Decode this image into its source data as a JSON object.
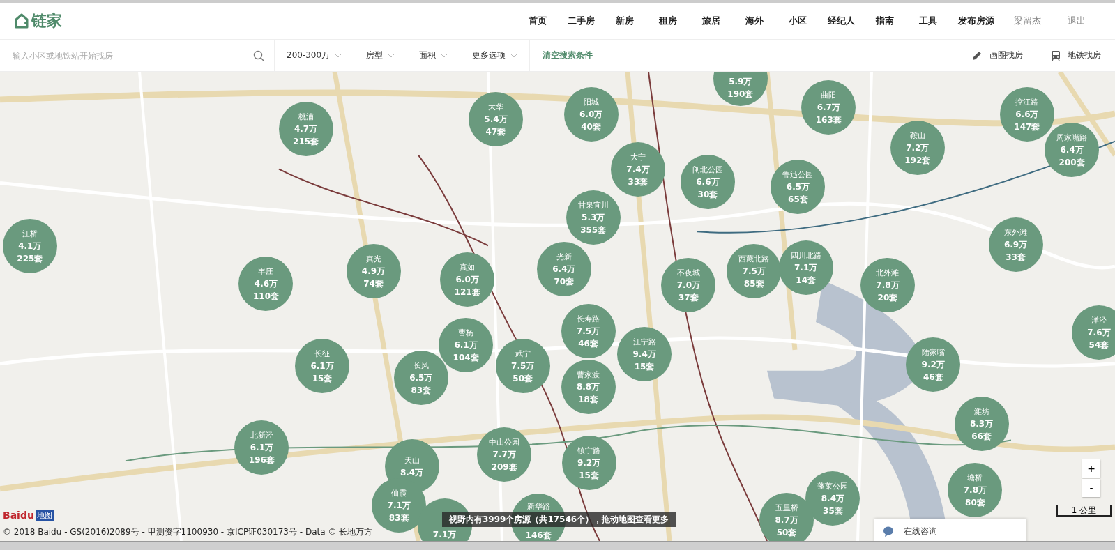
{
  "header": {
    "logo": "链家",
    "nav": [
      {
        "label": "首页",
        "kind": "main"
      },
      {
        "label": "二手房",
        "kind": "main"
      },
      {
        "label": "新房",
        "kind": "main"
      },
      {
        "label": "租房",
        "kind": "main"
      },
      {
        "label": "旅居",
        "kind": "main"
      },
      {
        "label": "海外",
        "kind": "main"
      },
      {
        "label": "小区",
        "kind": "main"
      },
      {
        "label": "经纪人",
        "kind": "main"
      },
      {
        "label": "指南",
        "kind": "main"
      },
      {
        "label": "工具",
        "kind": "main"
      },
      {
        "label": "发布房源",
        "kind": "main"
      },
      {
        "label": "梁留杰",
        "kind": "user"
      },
      {
        "label": "退出",
        "kind": "user"
      }
    ]
  },
  "filter_bar": {
    "search": {
      "placeholder": "输入小区或地铁站开始找房"
    },
    "filters": [
      "200-300万",
      "房型",
      "面积",
      "更多选项"
    ],
    "clear": "清空搜索条件",
    "tools": [
      {
        "label": "画圈找房",
        "kind": "draw"
      },
      {
        "label": "地铁找房",
        "kind": "subway"
      }
    ]
  },
  "map": {
    "bubbles": [
      {
        "price": "5.9万",
        "count": "190套"
      },
      {
        "name": "桃浦",
        "price": "4.7万",
        "count": "215套"
      },
      {
        "name": "大华",
        "price": "5.4万",
        "count": "47套"
      },
      {
        "name": "阳城",
        "price": "6.0万",
        "count": "40套"
      },
      {
        "name": "曲阳",
        "price": "6.7万",
        "count": "163套"
      },
      {
        "name": "控江路",
        "price": "6.6万",
        "count": "147套"
      },
      {
        "name": "鞍山",
        "price": "7.2万",
        "count": "192套"
      },
      {
        "name": "周家嘴路",
        "price": "6.4万",
        "count": "200套"
      },
      {
        "name": "大宁",
        "price": "7.4万",
        "count": "33套"
      },
      {
        "name": "闸北公园",
        "price": "6.6万",
        "count": "30套"
      },
      {
        "name": "鲁迅公园",
        "price": "6.5万",
        "count": "65套"
      },
      {
        "name": "甘泉宜川",
        "price": "5.3万",
        "count": "355套"
      },
      {
        "name": "江桥",
        "price": "4.1万",
        "count": "225套"
      },
      {
        "name": "东外滩",
        "price": "6.9万",
        "count": "33套"
      },
      {
        "name": "真光",
        "price": "4.9万",
        "count": "74套"
      },
      {
        "name": "丰庄",
        "price": "4.6万",
        "count": "110套"
      },
      {
        "name": "真如",
        "price": "6.0万",
        "count": "121套"
      },
      {
        "name": "光新",
        "price": "6.4万",
        "count": "70套"
      },
      {
        "name": "西藏北路",
        "price": "7.5万",
        "count": "85套"
      },
      {
        "name": "四川北路",
        "price": "7.1万",
        "count": "14套"
      },
      {
        "name": "不夜城",
        "price": "7.0万",
        "count": "37套"
      },
      {
        "name": "北外滩",
        "price": "7.8万",
        "count": "20套"
      },
      {
        "name": "长寿路",
        "price": "7.5万",
        "count": "46套"
      },
      {
        "name": "曹杨",
        "price": "6.1万",
        "count": "104套"
      },
      {
        "name": "江宁路",
        "price": "9.4万",
        "count": "15套"
      },
      {
        "name": "洋泾",
        "price": "7.6万",
        "count": "54套"
      },
      {
        "name": "长征",
        "price": "6.1万",
        "count": "15套"
      },
      {
        "name": "武宁",
        "price": "7.5万",
        "count": "50套"
      },
      {
        "name": "陆家嘴",
        "price": "9.2万",
        "count": "46套"
      },
      {
        "name": "长风",
        "price": "6.5万",
        "count": "83套"
      },
      {
        "name": "曹家渡",
        "price": "8.8万",
        "count": "18套"
      },
      {
        "name": "潍坊",
        "price": "8.3万",
        "count": "66套"
      },
      {
        "name": "北新泾",
        "price": "6.1万",
        "count": "196套"
      },
      {
        "name": "天山",
        "price": "8.4万"
      },
      {
        "name": "中山公园",
        "price": "7.7万",
        "count": "209套"
      },
      {
        "name": "镇宁路",
        "price": "9.2万",
        "count": "15套"
      },
      {
        "name": "仙霞",
        "price": "7.1万",
        "count": "83套"
      },
      {
        "name": "蓬莱公园",
        "price": "8.4万",
        "count": "35套"
      },
      {
        "name": "塘桥",
        "price": "7.8万",
        "count": "80套"
      },
      {
        "price": "7.1万"
      },
      {
        "name": "新华路",
        "count": "146套"
      },
      {
        "name": "五里桥",
        "price": "8.7万",
        "count": "50套"
      }
    ],
    "notice": "视野内有3999个房源（共17546个），拖动地图查看更多",
    "zoom": [
      "+",
      "-"
    ],
    "scale": "1 公里",
    "map_logo": "地图",
    "map_logo_brand": "Baidu",
    "copyright": "© 2018 Baidu - GS(2016)2089号 - 甲测资字1100930 - 京ICP证030173号 - Data © 长地万方",
    "consult": "在线咨询"
  }
}
